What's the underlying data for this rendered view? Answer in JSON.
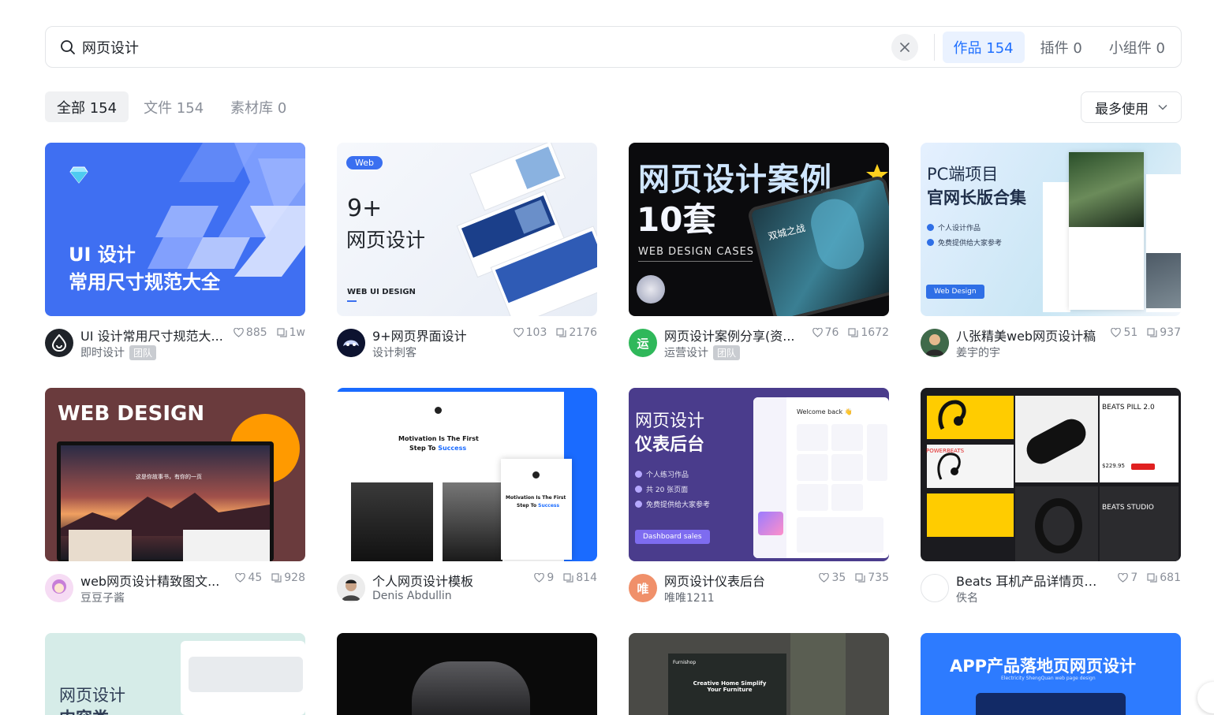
{
  "search": {
    "query": "网页设计",
    "tabs": [
      {
        "label": "作品 154"
      },
      {
        "label": "插件 0"
      },
      {
        "label": "小组件 0"
      }
    ]
  },
  "filters": {
    "tabs": [
      {
        "label": "全部 154"
      },
      {
        "label": "文件 154"
      },
      {
        "label": "素材库 0"
      }
    ],
    "sort": "最多使用"
  },
  "cards": [
    {
      "title": "UI 设计常用尺寸规范大...",
      "author": "即时设计",
      "badge": "团队",
      "likes": "885",
      "uses": "1w",
      "thumb": {
        "line1": "UI 设计",
        "line2": "常用尺寸规范大全"
      }
    },
    {
      "title": "9+网页界面设计",
      "author": "设计刺客",
      "likes": "103",
      "uses": "2176",
      "thumb": {
        "tag": "Web",
        "line1": "9+",
        "line2": "网页设计",
        "foot": "WEB UI DESIGN"
      }
    },
    {
      "title": "网页设计案例分享(资...",
      "author": "运营设计",
      "badge": "团队",
      "likes": "76",
      "uses": "1672",
      "avatar_text": "运",
      "thumb": {
        "line1": "网页设计案例",
        "line2": "10套",
        "foot": "WEB DESIGN CASES",
        "tv": "双城之战"
      }
    },
    {
      "title": "八张精美web网页设计稿",
      "author": "姜宇的宇",
      "likes": "51",
      "uses": "937",
      "thumb": {
        "line1": "PC端项目",
        "line2": "官网长版合集",
        "b1": "个人设计作品",
        "b2": "免费提供给大家参考",
        "btn": "Web Design"
      }
    },
    {
      "title": "web网页设计精致图文...",
      "author": "豆豆子酱",
      "likes": "45",
      "uses": "928",
      "thumb": {
        "line1": "WEB DESIGN",
        "sub": "这是你故事书，有你的一页"
      }
    },
    {
      "title": "个人网页设计模板",
      "author": "Denis Abdullin",
      "likes": "9",
      "uses": "814",
      "thumb": {
        "line1": "Motivation Is The First",
        "line2a": "Step To ",
        "line2b": "Success"
      }
    },
    {
      "title": "网页设计仪表后台",
      "author": "唯唯1211",
      "likes": "35",
      "uses": "735",
      "avatar_text": "唯",
      "thumb": {
        "line1": "网页设计",
        "line2": "仪表后台",
        "b1": "个人练习作品",
        "b2": "共 20 张页面",
        "b3": "免费提供给大家参考",
        "btn": "Dashboard sales",
        "welcome": "Welcome back 👋"
      }
    },
    {
      "title": "Beats 耳机产品详情页设...",
      "author": "佚名",
      "likes": "7",
      "uses": "681",
      "thumb": {
        "l1": "BEATS PILL 2.0",
        "l2": "BEATS STUDIO",
        "l3": "POWERBEATS",
        "price": "$229.95"
      }
    },
    {
      "thumb": {
        "line1": "网页设计",
        "line2": "内容类"
      }
    },
    {
      "thumb": {}
    },
    {
      "thumb": {
        "line1": "Creative Home Simplify Your Furniture",
        "brand": "Furnishop"
      }
    },
    {
      "thumb": {
        "line1": "APP产品落地页网页设计",
        "sub": "Electricity ShengQuan web page design"
      }
    }
  ]
}
